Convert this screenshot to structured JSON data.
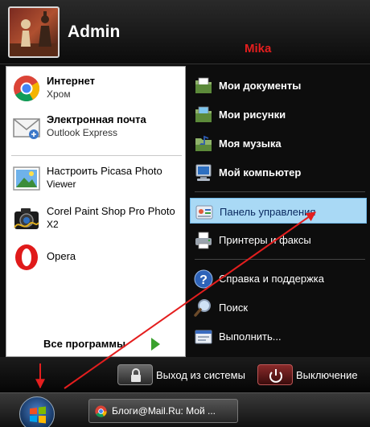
{
  "user": {
    "name": "Admin"
  },
  "watermark": {
    "text": "Mika"
  },
  "pinned": [
    {
      "title": "Интернет",
      "subtitle": "Хром",
      "icon": "chrome-icon"
    },
    {
      "title": "Электронная почта",
      "subtitle": "Outlook Express",
      "icon": "mail-icon"
    }
  ],
  "recent": [
    {
      "line1": "Настроить Picasa Photo",
      "line2": "Viewer",
      "icon": "picasa-icon"
    },
    {
      "line1": "Corel Paint Shop Pro Photo",
      "line2": "X2",
      "icon": "corel-icon"
    },
    {
      "line1": "Opera",
      "line2": "",
      "icon": "opera-icon"
    }
  ],
  "all_programs": {
    "label": "Все программы"
  },
  "places": [
    {
      "label": "Мои документы",
      "icon": "documents-icon"
    },
    {
      "label": "Мои рисунки",
      "icon": "pictures-icon"
    },
    {
      "label": "Моя музыка",
      "icon": "music-icon"
    },
    {
      "label": "Мой компьютер",
      "icon": "computer-icon"
    }
  ],
  "system": [
    {
      "label": "Панель управления",
      "icon": "control-panel-icon",
      "highlighted": true
    },
    {
      "label": "Принтеры и факсы",
      "icon": "printer-icon"
    }
  ],
  "support": [
    {
      "label": "Справка и поддержка",
      "icon": "help-icon"
    },
    {
      "label": "Поиск",
      "icon": "search-icon"
    },
    {
      "label": "Выполнить...",
      "icon": "run-icon"
    }
  ],
  "footer": {
    "logoff": "Выход из системы",
    "shutdown": "Выключение"
  },
  "taskbar": {
    "item": "Блоги@Mail.Ru: Мой ..."
  },
  "colors": {
    "highlight": "#a9d9f5",
    "annotation_arrow": "#e41e1e",
    "watermark": "#e41e1e"
  }
}
